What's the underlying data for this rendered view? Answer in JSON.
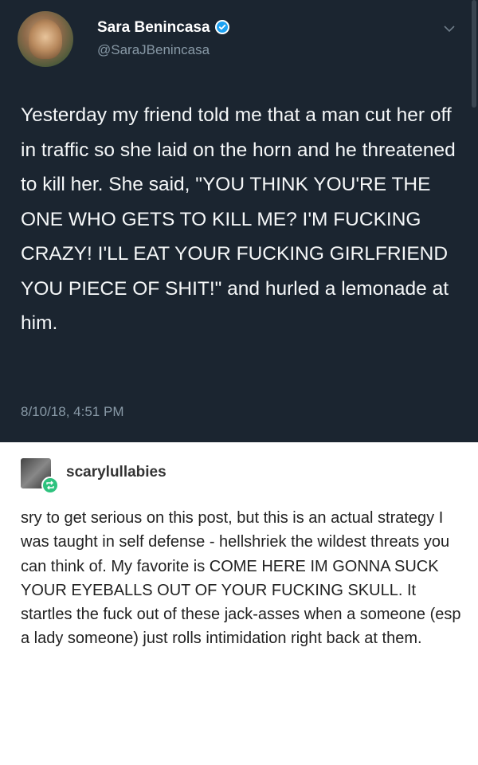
{
  "tweet": {
    "display_name": "Sara Benincasa",
    "handle": "@SaraJBenincasa",
    "verified": true,
    "text": "Yesterday my friend told me that a man cut her off in traffic so she laid on the horn and he  threatened to kill her. She said, \"YOU THINK YOU'RE THE ONE WHO GETS TO KILL ME? I'M FUCKING CRAZY! I'LL EAT YOUR FUCKING GIRLFRIEND YOU PIECE OF SHIT!\" and hurled a lemonade at him.",
    "timestamp": "8/10/18, 4:51 PM",
    "background_color": "#1b2530",
    "icons": [
      "avatar",
      "verified-icon",
      "chevron-down-icon"
    ]
  },
  "reply": {
    "username": "scarylullabies",
    "text": "sry to get serious on this post, but this is an actual strategy I was taught in self defense - hellshriek the wildest threats you can think of. My favorite is COME HERE IM GONNA SUCK YOUR EYEBALLS OUT OF YOUR FUCKING SKULL. It startles the fuck out of these jack-asses when a someone (esp a lady someone) just rolls intimidation right back at them.",
    "icons": [
      "avatar",
      "reblog-icon"
    ],
    "badge_color": "#2ec27e"
  }
}
